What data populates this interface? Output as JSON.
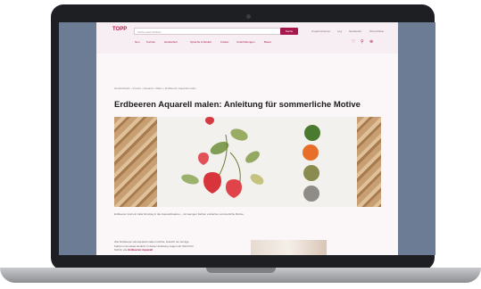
{
  "header": {
    "logo": "TOPP",
    "search_placeholder": "Suche nach Artikeln",
    "search_button": "Suche",
    "meta_links": [
      "Ungebrochenes",
      "Log",
      "Newsletter",
      "Wunschliste"
    ],
    "nav": [
      "Neu",
      "Kochen",
      "Handarbeit",
      "Sprache & Modell",
      "Kreativ",
      "Unterhaltungen",
      "Basar"
    ]
  },
  "article": {
    "breadcrumb": "Handarbeiten › Kreativ › Aquarell › Malen › Erdbeeren Aquarell malen",
    "title": "Erdbeeren Aquarell malen: Anleitung für sommerliche Motive",
    "caption": "Erdbeeren sind ein toller Einstieg in die Aquarellmalerei – mit wenigen Farben entstehen sommerliche Motive.",
    "paragraph_text": "Wer Erdbeeren als Aquarell malen möchte, braucht nur wenige Farben und etwas Geduld. In dieser Anleitung zeigen wir Schritt für Schritt, wie",
    "paragraph_link": "Erdbeeren Aquarell"
  },
  "colors": {
    "brand": "#a7174d",
    "swatches": [
      "#e76f2a",
      "#4a7a2f",
      "#8a8b4f",
      "#8f8b86"
    ]
  }
}
